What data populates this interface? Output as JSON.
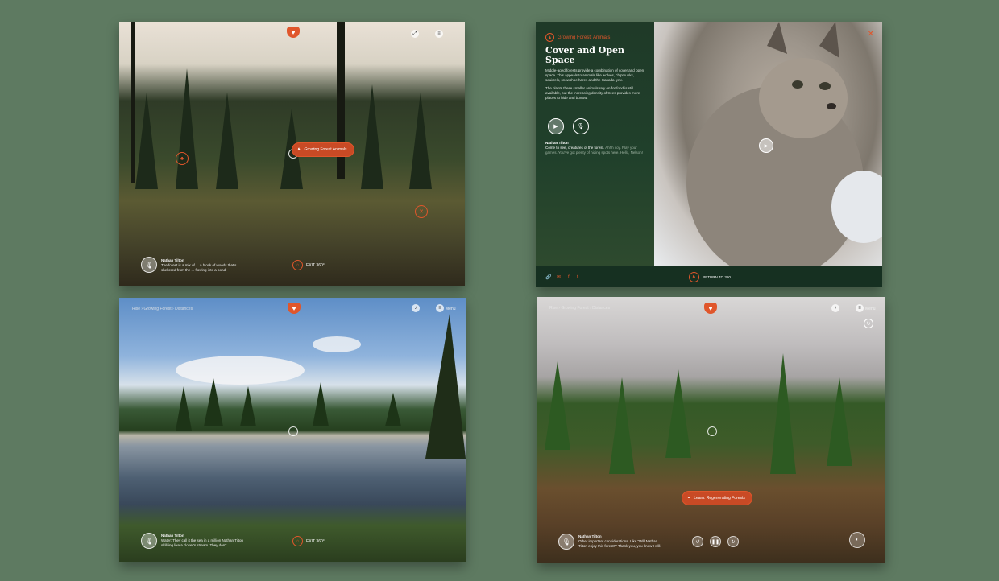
{
  "brand": {
    "accent": "#e0562b",
    "dark_green": "#163021",
    "background": "#5e7a61"
  },
  "panel_forest": {
    "popup_label": "Growing Forest Animals",
    "narration": {
      "name": "Nathan Tilton",
      "text": "The forest is a mix of ... a block of woods that's sheltered from the ... flowing into a pond."
    },
    "exit_label": "EXIT 360°"
  },
  "panel_lynx": {
    "section_tag": "Growing Forest: Animals",
    "title": "Cover and Open Space",
    "para1": "Middle-aged forests provide a combination of cover and open space. This appeals to animals like wolves, chipmunks, squirrels, snowshoe hares and the Canada lynx.",
    "para2": "The plants these smaller animals rely on for food is still available, but the increasing density of trees provides more places to hide and burrow.",
    "narrator_name": "Nathan Tilton",
    "quote_lead": "Come to see, creatures of the forest.",
    "quote_rest": "Ahhh coy. Play your games. You've got plenty of hiding spots here. Hello, Nelson!",
    "return_label": "RETURN TO 360",
    "social_icons": [
      "link-icon",
      "mail-icon",
      "facebook-icon",
      "twitter-icon"
    ]
  },
  "panel_river": {
    "breadcrumb": [
      "Rise",
      "Growing Forest",
      "Distances"
    ],
    "menu_label": "Menu",
    "narration": {
      "name": "Nathan Tilton",
      "text": "Water: They call it the sea in a million Nathan Tilton skill-ing like a closer's stream. They don't"
    },
    "exit_label": "EXIT 360°"
  },
  "panel_regrowth": {
    "breadcrumb": [
      "Rise",
      "Growing Forest",
      "Distances"
    ],
    "menu_label": "Menu",
    "popup_label": "Learn: Regenerating Forests",
    "narration": {
      "name": "Nathan Tilton",
      "text": "Other important considerations. Like \"Will Nathan Tilton enjoy this forest?\" Thank you, you know I will."
    }
  }
}
